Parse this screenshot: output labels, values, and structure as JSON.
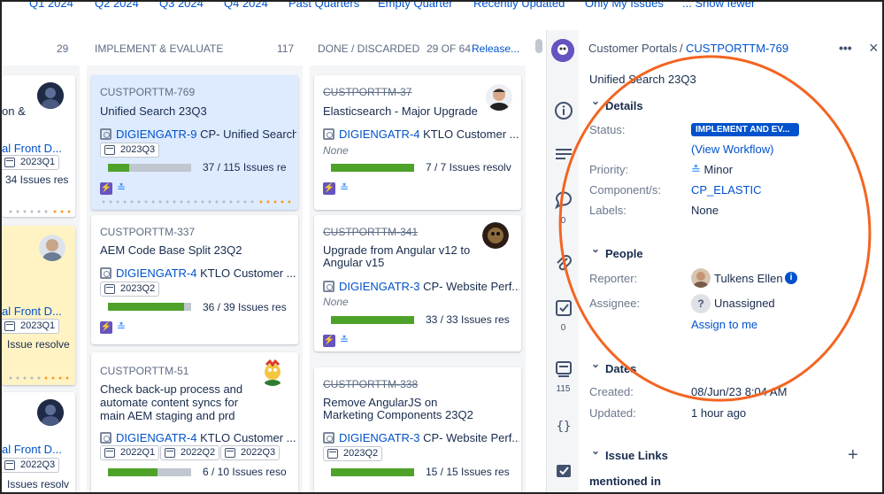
{
  "quick_filters": [
    "Q1 2024",
    "Q2 2024",
    "Q3 2024",
    "Q4 2024",
    "Past Quarters",
    "Empty Quarter",
    "Recently Updated",
    "Only My Issues",
    "... Show fewer"
  ],
  "columns": {
    "first": {
      "count": "29"
    },
    "implement": {
      "title": "IMPLEMENT & EVALUATE",
      "count": "117"
    },
    "done": {
      "title": "DONE / DISCARDED",
      "count": "29 OF 64",
      "release": "Release..."
    }
  },
  "left_cards": [
    {
      "summary": "on &",
      "epic": "al Front D...",
      "version": "2023Q1",
      "progress": "34 Issues res"
    },
    {
      "epic": "al Front D...",
      "version": "2023Q1",
      "progress": "Issue resolve"
    },
    {
      "epic": "al Front D...",
      "version": "2022Q3",
      "progress": "Issues resolv"
    }
  ],
  "implement_cards": [
    {
      "key": "CUSTPORTTM-769",
      "summary": "Unified Search 23Q3",
      "epic_key": "DIGIENGATR-9",
      "epic_name": "CP- Unified Search",
      "versions": [
        "2023Q3"
      ],
      "progress_fraction": 0.26,
      "progress_text": "37 / 115 Issues re"
    },
    {
      "key": "CUSTPORTTM-337",
      "summary": "AEM Code Base Split 23Q2",
      "epic_key": "DIGIENGATR-4",
      "epic_name": "KTLO Customer ...",
      "versions": [
        "2023Q2"
      ],
      "progress_fraction": 0.92,
      "progress_text": "36 / 39 Issues res"
    },
    {
      "key": "CUSTPORTTM-51",
      "summary_lines": [
        "Check back-up process and",
        "automate content syncs for",
        "main AEM staging and prd"
      ],
      "epic_key": "DIGIENGATR-4",
      "epic_name": "KTLO Customer ...",
      "versions": [
        "2022Q1",
        "2022Q2",
        "2022Q3"
      ],
      "progress_fraction": 0.6,
      "progress_text": "6 / 10 Issues reso"
    }
  ],
  "done_cards": [
    {
      "key": "CUSTPORTTM-37",
      "summary": "Elasticsearch - Major Upgrade",
      "epic_key": "DIGIENGATR-4",
      "epic_name": "KTLO Customer ...",
      "none_label": "None",
      "progress_fraction": 1.0,
      "progress_text": "7 / 7 Issues resolv"
    },
    {
      "key": "CUSTPORTTM-341",
      "summary_lines": [
        "Upgrade from Angular v12 to",
        "Angular v15"
      ],
      "epic_key": "DIGIENGATR-3",
      "epic_name": "CP- Website Perf...",
      "none_label": "None",
      "progress_fraction": 1.0,
      "progress_text": "33 / 33 Issues res"
    },
    {
      "key": "CUSTPORTTM-338",
      "summary_lines": [
        "Remove AngularJS on",
        "Marketing Components 23Q2"
      ],
      "epic_key": "DIGIENGATR-3",
      "epic_name": "CP- Website Perf...",
      "versions": [
        "2023Q2"
      ],
      "progress_fraction": 1.0,
      "progress_text": "15 / 15 Issues res"
    }
  ],
  "rail": {
    "comments_count": "0",
    "checklist_count": "0",
    "work_count": "115"
  },
  "detail": {
    "breadcrumb_project": "Customer Portals",
    "breadcrumb_sep": "/",
    "issue_key": "CUSTPORTTM-769",
    "more_label": "•••",
    "close_label": "×",
    "title": "Unified Search 23Q3",
    "details_header": "Details",
    "status_label": "Status:",
    "status_value": "IMPLEMENT AND EV...",
    "view_workflow": "(View Workflow)",
    "priority_label": "Priority:",
    "priority_value": "Minor",
    "component_label": "Component/s:",
    "component_value": "CP_ELASTIC",
    "labels_label": "Labels:",
    "labels_value": "None",
    "people_header": "People",
    "reporter_label": "Reporter:",
    "reporter_value": "Tulkens Ellen",
    "assignee_label": "Assignee:",
    "assignee_value": "Unassigned",
    "assign_to_me": "Assign to me",
    "dates_header": "Dates",
    "created_label": "Created:",
    "created_value": "08/Jun/23 8:04 AM",
    "updated_label": "Updated:",
    "updated_value": "1 hour ago",
    "links_header": "Issue Links",
    "add_label": "+",
    "mentioned_in": "mentioned in"
  },
  "colors": {
    "link": "#0052cc",
    "progress": "#4ea22a",
    "status": "#0052cc",
    "annotation": "#f26522",
    "selected_card": "#deebff",
    "flagged_card": "#fff3c4"
  }
}
